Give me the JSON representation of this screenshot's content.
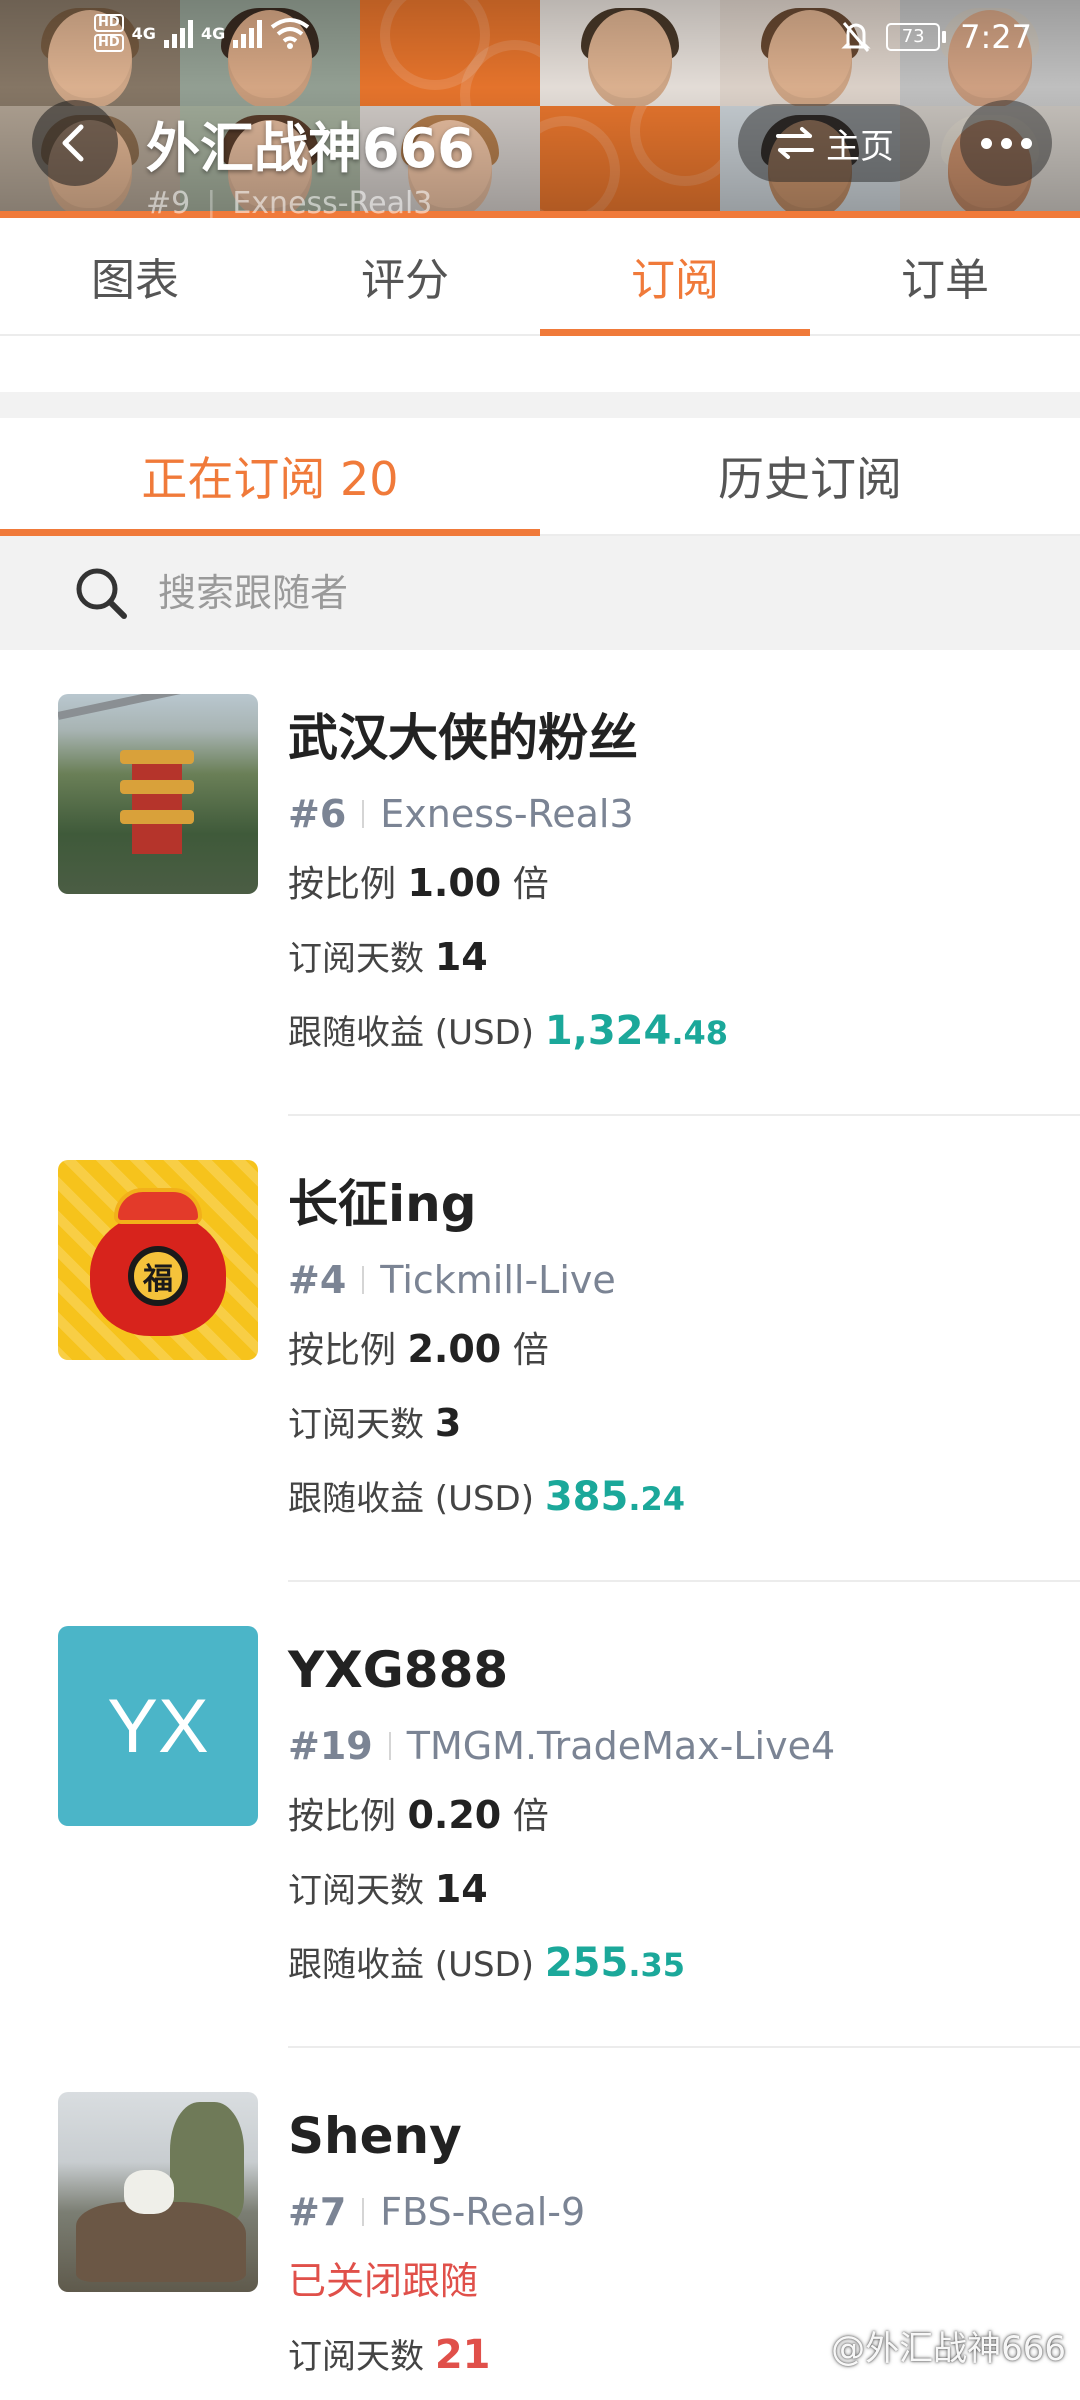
{
  "status_bar": {
    "hd1": "HD",
    "hd2": "HD",
    "net1": "4G",
    "net2": "4G",
    "battery": "73",
    "time": "7:27"
  },
  "header": {
    "title": "外汇战神666",
    "rank": "#9",
    "broker": "Exness-Real3",
    "home_label": "主页"
  },
  "main_tabs": [
    {
      "label": "图表",
      "active": false
    },
    {
      "label": "评分",
      "active": false
    },
    {
      "label": "订阅",
      "active": true
    },
    {
      "label": "订单",
      "active": false
    }
  ],
  "sub_tabs": {
    "current": "正在订阅 20",
    "history": "历史订阅"
  },
  "search": {
    "placeholder": "搜索跟随者",
    "value": ""
  },
  "labels": {
    "ratio_prefix": "按比例",
    "ratio_suffix": "倍",
    "days": "订阅天数",
    "gain": "跟随收益 (USD)"
  },
  "followers": [
    {
      "name": "武汉大侠的粉丝",
      "rank": "#6",
      "broker": "Exness-Real3",
      "ratio": "1.00",
      "days": "14",
      "gain_main": "1,324",
      "gain_decimal": ".48"
    },
    {
      "name": "长征ing",
      "rank": "#4",
      "broker": "Tickmill-Live",
      "ratio": "2.00",
      "days": "3",
      "gain_main": "385",
      "gain_decimal": ".24",
      "avatar_char": "福"
    },
    {
      "name": "YXG888",
      "rank": "#19",
      "broker": "TMGM.TradeMax-Live4",
      "ratio": "0.20",
      "days": "14",
      "gain_main": "255",
      "gain_decimal": ".35",
      "avatar_text": "YX"
    },
    {
      "name": "Sheny",
      "rank": "#7",
      "broker": "FBS-Real-9",
      "status": "已关闭跟随",
      "days": "21"
    }
  ],
  "watermark": "@外汇战神666",
  "colors": {
    "accent": "#f07a3a",
    "gain": "#1ba89a",
    "closed": "#e0504a",
    "muted": "#7b8494"
  },
  "icons": [
    "back-arrow-icon",
    "swap-icon",
    "more-dots-icon",
    "search-icon",
    "wifi-icon",
    "signal-icon",
    "mute-icon",
    "battery-icon"
  ]
}
